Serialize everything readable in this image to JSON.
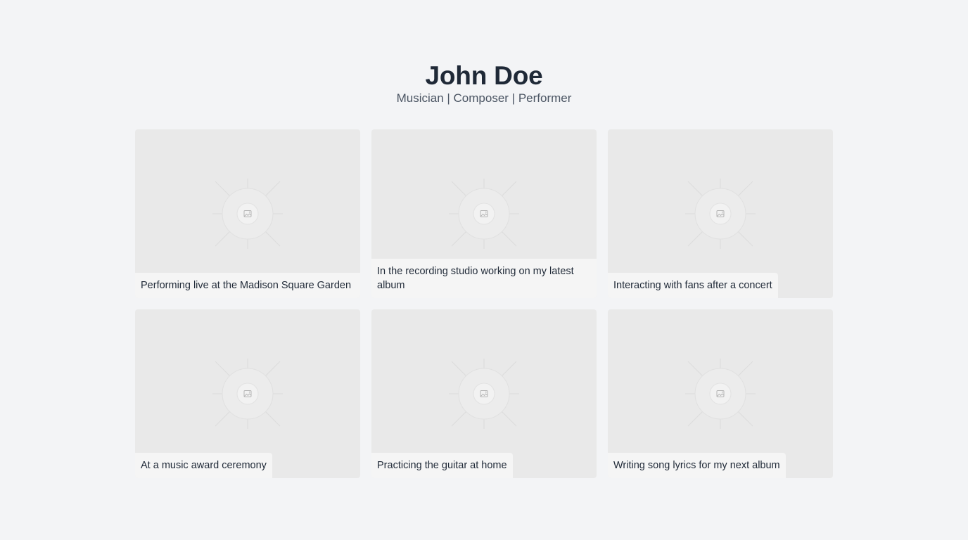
{
  "header": {
    "title": "John Doe",
    "subtitle": "Musician | Composer | Performer"
  },
  "gallery": {
    "items": [
      {
        "caption": "Performing live at the Madison Square Garden",
        "icon": "image-placeholder-icon"
      },
      {
        "caption": "In the recording studio working on my latest album",
        "icon": "image-placeholder-icon"
      },
      {
        "caption": "Interacting with fans after a concert",
        "icon": "image-placeholder-icon"
      },
      {
        "caption": "At a music award ceremony",
        "icon": "image-placeholder-icon"
      },
      {
        "caption": "Practicing the guitar at home",
        "icon": "image-placeholder-icon"
      },
      {
        "caption": "Writing song lyrics for my next album",
        "icon": "image-placeholder-icon"
      }
    ]
  },
  "colors": {
    "background": "#f3f4f6",
    "card_background": "#e9e9e9",
    "caption_background": "#f5f5f5",
    "title_text": "#1f2937",
    "subtitle_text": "#4b5563"
  }
}
